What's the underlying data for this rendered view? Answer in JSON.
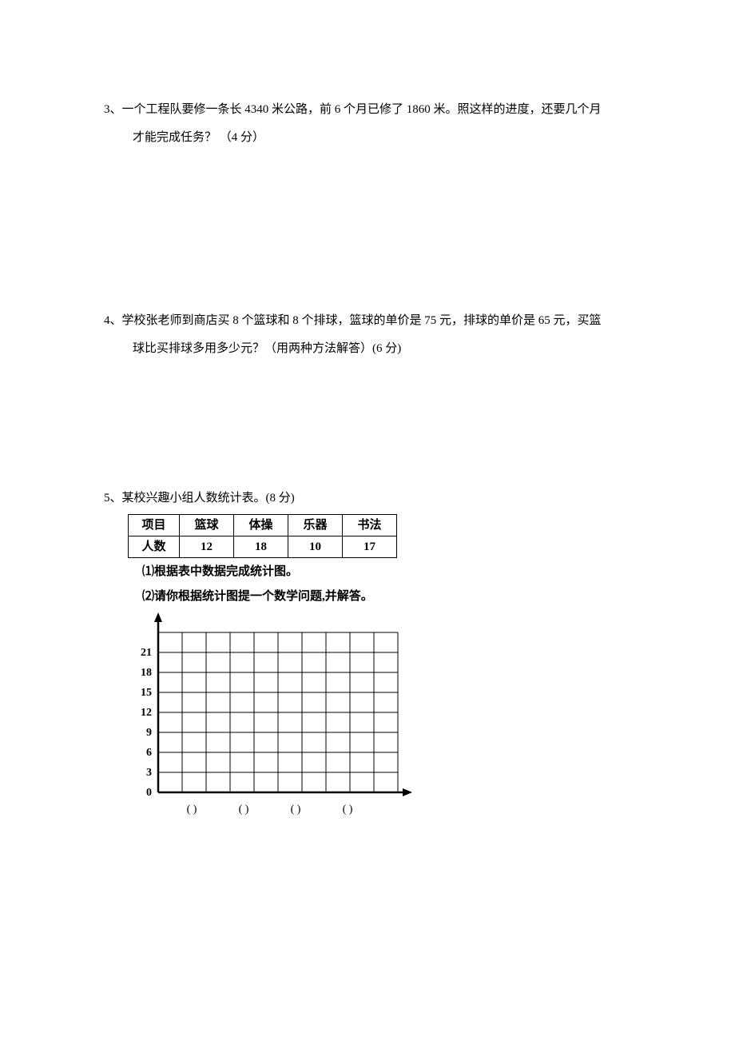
{
  "q3": {
    "line1": "3、一个工程队要修一条长 4340 米公路，前 6 个月已修了 1860 米。照这样的进度，还要几个月",
    "line2": "才能完成任务？ （4 分）"
  },
  "q4": {
    "line1": "4、学校张老师到商店买 8 个篮球和 8 个排球，篮球的单价是 75 元，排球的单价是 65 元，买篮",
    "line2": "球比买排球多用多少元？（用两种方法解答）(6 分)"
  },
  "q5": {
    "header": "5、某校兴趣小组人数统计表。(8 分)",
    "table": {
      "row_labels": [
        "项目",
        "人数"
      ],
      "columns": [
        "篮球",
        "体操",
        "乐器",
        "书法"
      ],
      "values": [
        "12",
        "18",
        "10",
        "17"
      ]
    },
    "sub1": "⑴根据表中数据完成统计图。",
    "sub2": "⑵请你根据统计图提一个数学问题,并解答。",
    "chart_data": {
      "type": "bar",
      "categories": [
        "",
        "",
        "",
        ""
      ],
      "values": [
        null,
        null,
        null,
        null
      ],
      "y_ticks": [
        "0",
        "3",
        "6",
        "9",
        "12",
        "15",
        "18",
        "21"
      ],
      "ylim": [
        0,
        24
      ],
      "grid": true,
      "x_blanks": [
        "(      )",
        "(      )",
        "(      )",
        "(      )"
      ],
      "note": "Blank bar chart grid; students fill bars for 篮球=12, 体操=18, 乐器=10, 书法=17"
    }
  }
}
